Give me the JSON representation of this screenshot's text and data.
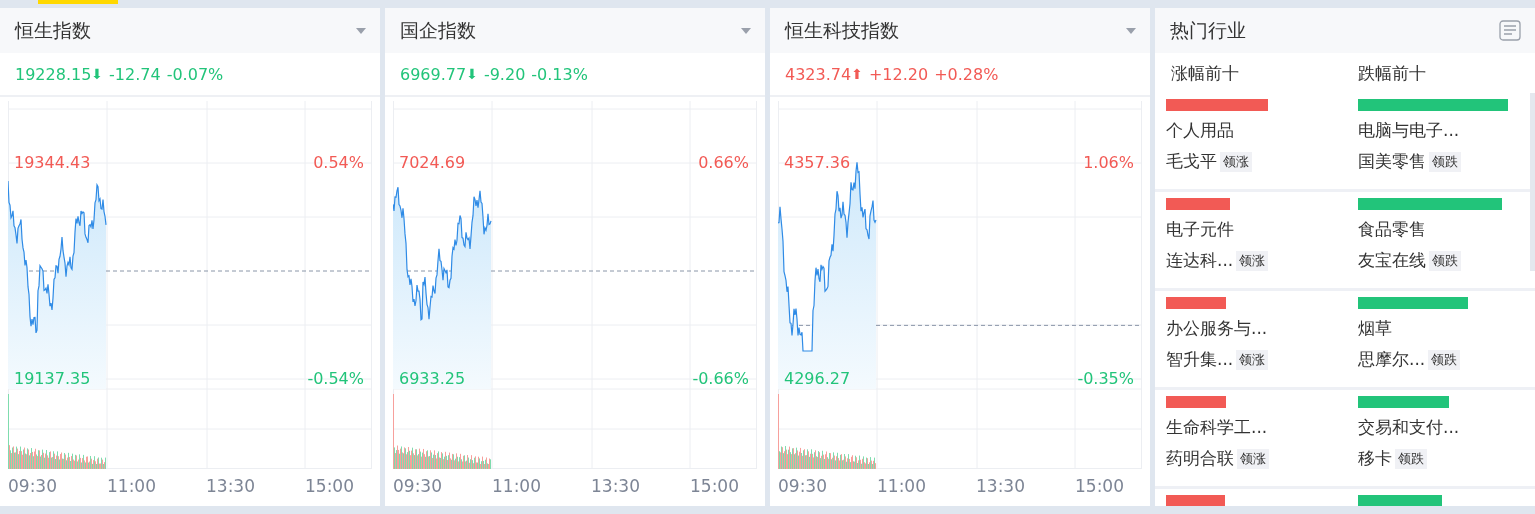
{
  "index_panels": [
    {
      "title": "恒生指数",
      "price": "19228.15",
      "arrow": "⬇",
      "color": "#22c47a",
      "change": "-12.74",
      "percent": "-0.07%",
      "high": "19344.43",
      "high_pct": "0.54%",
      "low": "19137.35",
      "low_pct": "-0.54%",
      "times": [
        "09:30",
        "11:00",
        "13:30",
        "15:00"
      ]
    },
    {
      "title": "国企指数",
      "price": "6969.77",
      "arrow": "⬇",
      "color": "#22c47a",
      "change": "-9.20",
      "percent": "-0.13%",
      "high": "7024.69",
      "high_pct": "0.66%",
      "low": "6933.25",
      "low_pct": "-0.66%",
      "times": [
        "09:30",
        "11:00",
        "13:30",
        "15:00"
      ]
    },
    {
      "title": "恒生科技指数",
      "price": "4323.74",
      "arrow": "⬆",
      "color": "#f25a55",
      "change": "+12.20",
      "percent": "+0.28%",
      "high": "4357.36",
      "high_pct": "1.06%",
      "low": "4296.27",
      "low_pct": "-0.35%",
      "times": [
        "09:30",
        "11:00",
        "13:30",
        "15:00"
      ]
    }
  ],
  "industry": {
    "title": "热门行业",
    "columns": [
      "涨幅前十",
      "跌幅前十"
    ],
    "rows": [
      {
        "rise": {
          "level": 0.66,
          "name": "个人用品",
          "leader": "毛戈平",
          "tag": "领涨"
        },
        "fall": {
          "level": 0.97,
          "name": "电脑与电子...",
          "leader": "国美零售",
          "tag": "领跌"
        }
      },
      {
        "rise": {
          "level": 0.41,
          "name": "电子元件",
          "leader": "连达科...",
          "tag": "领涨"
        },
        "fall": {
          "level": 0.93,
          "name": "食品零售",
          "leader": "友宝在线",
          "tag": "领跌"
        }
      },
      {
        "rise": {
          "level": 0.39,
          "name": "办公服务与...",
          "leader": "智升集...",
          "tag": "领涨"
        },
        "fall": {
          "level": 0.71,
          "name": "烟草",
          "leader": "思摩尔...",
          "tag": "领跌"
        }
      },
      {
        "rise": {
          "level": 0.39,
          "name": "生命科学工...",
          "leader": "药明合联",
          "tag": "领涨"
        },
        "fall": {
          "level": 0.59,
          "name": "交易和支付...",
          "leader": "移卡",
          "tag": "领跌"
        }
      },
      {
        "rise": {
          "level": 0.38
        },
        "fall": {
          "level": 0.54
        }
      }
    ]
  }
}
